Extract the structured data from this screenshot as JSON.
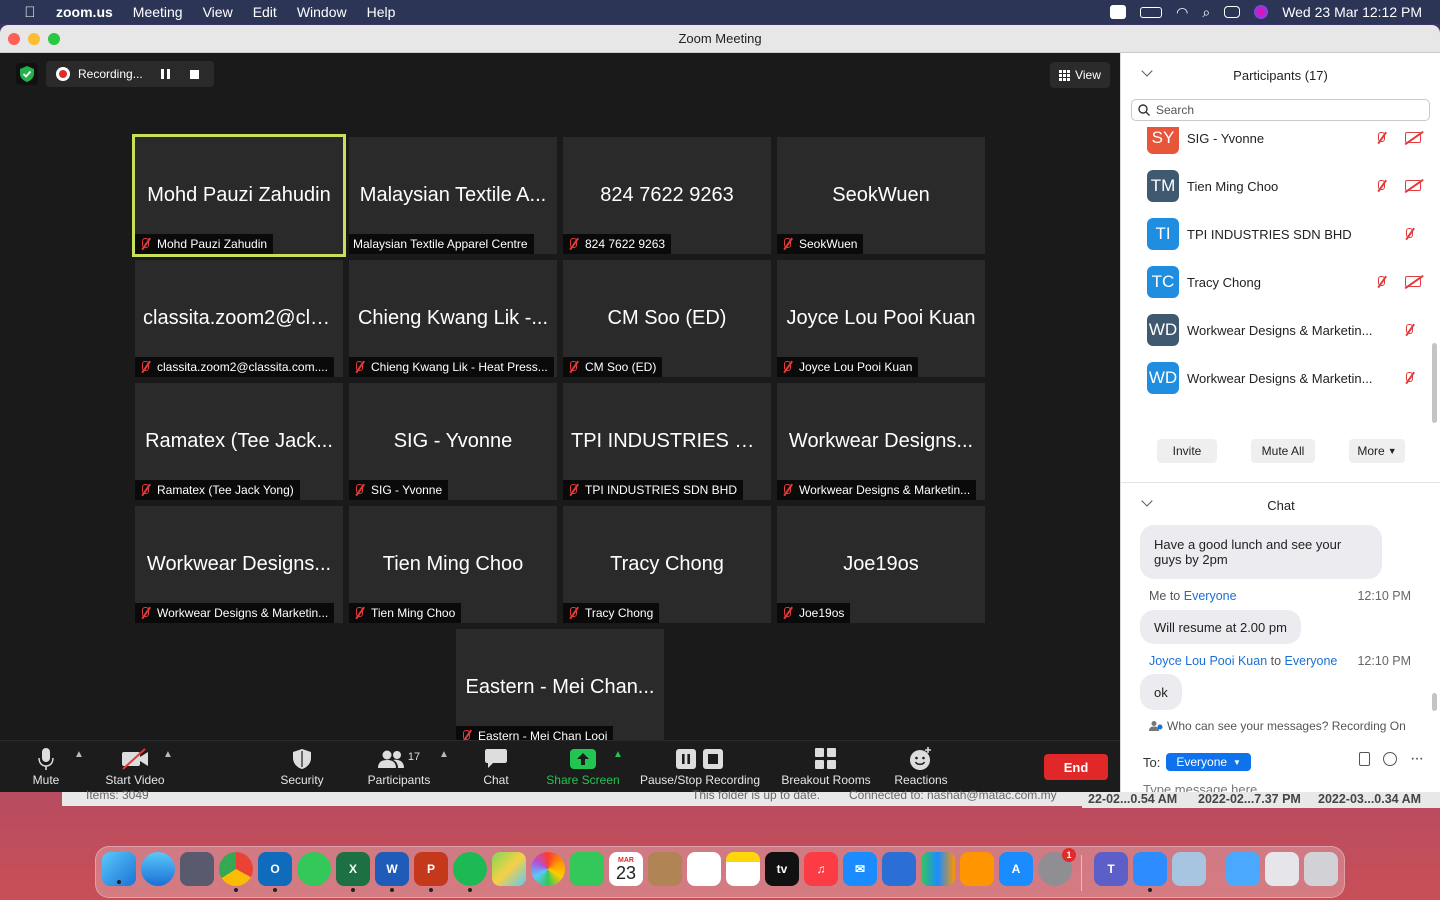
{
  "menubar": {
    "app": "zoom.us",
    "items": [
      "Meeting",
      "View",
      "Edit",
      "Window",
      "Help"
    ],
    "datetime": "Wed 23 Mar  12:12 PM"
  },
  "window": {
    "title": "Zoom Meeting"
  },
  "recording": {
    "label": "Recording..."
  },
  "view_button": "View",
  "tiles": [
    {
      "big": "Mohd Pauzi Zahudin",
      "label": "Mohd Pauzi Zahudin",
      "active": true
    },
    {
      "big": "Malaysian Textile A...",
      "label": "Malaysian Textile Apparel Centre"
    },
    {
      "big": "824 7622 9263",
      "label": "824 7622 9263"
    },
    {
      "big": "SeokWuen",
      "label": "SeokWuen"
    },
    {
      "big": "classita.zoom2@cla...",
      "label": "classita.zoom2@classita.com...."
    },
    {
      "big": "Chieng Kwang Lik -...",
      "label": "Chieng Kwang Lik - Heat Press..."
    },
    {
      "big": "CM Soo (ED)",
      "label": "CM Soo (ED)"
    },
    {
      "big": "Joyce Lou Pooi Kuan",
      "label": "Joyce Lou Pooi Kuan"
    },
    {
      "big": "Ramatex (Tee Jack...",
      "label": "Ramatex (Tee Jack Yong)"
    },
    {
      "big": "SIG - Yvonne",
      "label": "SIG - Yvonne"
    },
    {
      "big": "TPI INDUSTRIES S...",
      "label": "TPI INDUSTRIES SDN BHD"
    },
    {
      "big": "Workwear Designs...",
      "label": "Workwear Designs & Marketin..."
    },
    {
      "big": "Workwear Designs...",
      "label": "Workwear Designs & Marketin..."
    },
    {
      "big": "Tien Ming Choo",
      "label": "Tien Ming Choo"
    },
    {
      "big": "Tracy Chong",
      "label": "Tracy Chong"
    },
    {
      "big": "Joe19os",
      "label": "Joe19os"
    },
    {
      "big": "Eastern - Mei Chan...",
      "label": "Eastern - Mei Chan Looi"
    }
  ],
  "toolbar": {
    "mute": "Mute",
    "start_video": "Start Video",
    "security": "Security",
    "participants": "Participants",
    "participants_count": "17",
    "chat": "Chat",
    "share_screen": "Share Screen",
    "pause_stop": "Pause/Stop Recording",
    "breakout": "Breakout Rooms",
    "reactions": "Reactions",
    "end": "End"
  },
  "participants_panel": {
    "title": "Participants (17)",
    "search_placeholder": "Search",
    "rows": [
      {
        "initials": "SY",
        "name": "SIG - Yvonne",
        "color": "#e8553a",
        "video_off": true
      },
      {
        "initials": "TM",
        "name": "Tien Ming Choo",
        "color": "#3f5a70",
        "video_off": true
      },
      {
        "initials": "TI",
        "name": "TPI INDUSTRIES SDN BHD",
        "color": "#1f8ee0",
        "video_off": false
      },
      {
        "initials": "TC",
        "name": "Tracy Chong",
        "color": "#1f8ee0",
        "video_off": true
      },
      {
        "initials": "WD",
        "name": "Workwear Designs & Marketin...",
        "color": "#3f5a70",
        "video_off": false
      },
      {
        "initials": "WD",
        "name": "Workwear Designs & Marketin...",
        "color": "#1f8ee0",
        "video_off": false
      }
    ],
    "invite": "Invite",
    "mute_all": "Mute All",
    "more": "More"
  },
  "chat": {
    "title": "Chat",
    "msg1": "Have a good lunch and see your",
    "msg1b": "guys by 2pm",
    "meta2_from": "Me to ",
    "meta2_to": "Everyone",
    "meta2_time": "12:10 PM",
    "msg2": "Will resume at 2.00 pm",
    "meta3_from": "Joyce Lou Pooi Kuan",
    "meta3_mid": " to ",
    "meta3_to": "Everyone",
    "meta3_time": "12:10 PM",
    "msg3": "ok",
    "visibility": "Who can see your messages? Recording On",
    "to_label": "To:",
    "to_value": "Everyone",
    "placeholder": "Type message here..."
  },
  "finder": {
    "items": "Items: 3049",
    "status": "This folder is up to date.",
    "connected": "Connected to: nashah@matac.com.my",
    "d1": "22-02...0.54 AM",
    "d2": "2022-02...7.37 PM",
    "d3": "2022-03...0.34 AM"
  },
  "dock": {
    "calendar_month": "MAR",
    "calendar_day": "23",
    "appletv": "tv",
    "badge": "1"
  }
}
